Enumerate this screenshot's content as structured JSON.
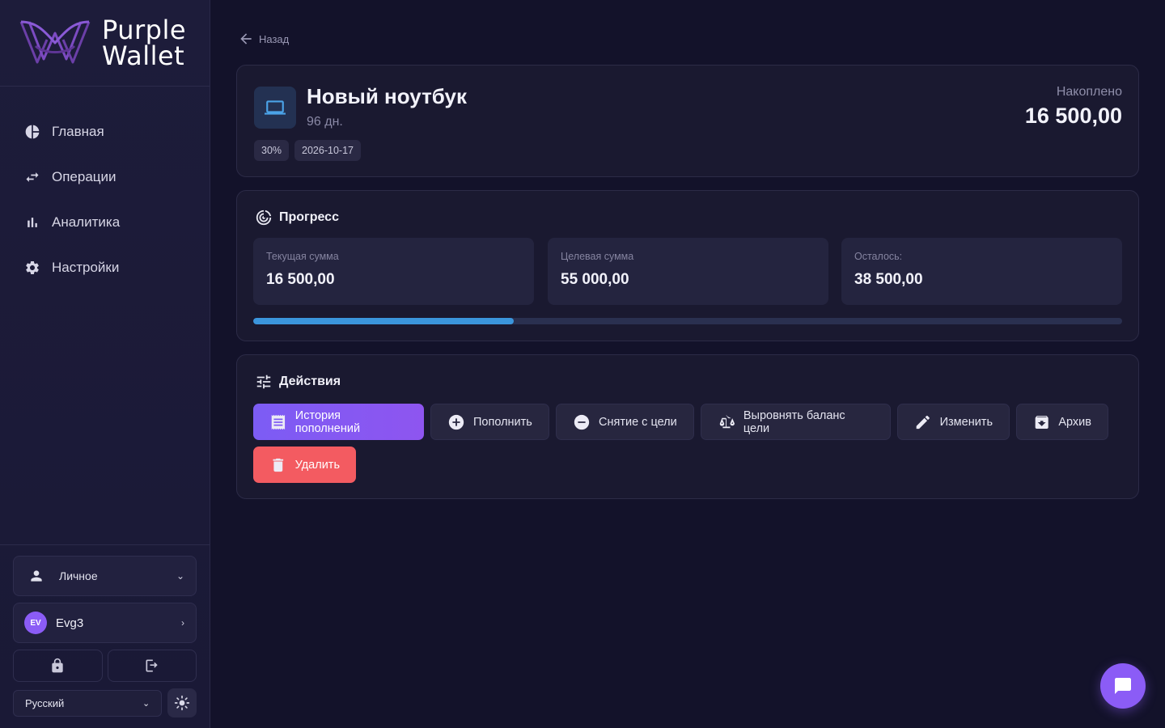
{
  "brand": {
    "line1": "Purple",
    "line2": "Wallet"
  },
  "nav": [
    {
      "label": "Главная",
      "icon": "pie-chart-icon"
    },
    {
      "label": "Операции",
      "icon": "transfer-arrows-icon"
    },
    {
      "label": "Аналитика",
      "icon": "bar-chart-icon"
    },
    {
      "label": "Настройки",
      "icon": "gear-icon"
    }
  ],
  "sidebar_bottom": {
    "account_type": "Личное",
    "user": {
      "initials": "EV",
      "name": "Evg3"
    },
    "language": "Русский"
  },
  "back_label": "Назад",
  "goal": {
    "title": "Новый ноутбук",
    "days": "96 дн.",
    "percent_chip": "30%",
    "date_chip": "2026-10-17",
    "accumulated_label": "Накоплено",
    "accumulated_value": "16 500,00",
    "icon": "laptop-icon"
  },
  "progress": {
    "title": "Прогресс",
    "current_label": "Текущая сумма",
    "current_value": "16 500,00",
    "target_label": "Целевая сумма",
    "target_value": "55 000,00",
    "remaining_label": "Осталось:",
    "remaining_value": "38 500,00",
    "fraction": 0.3
  },
  "actions": {
    "title": "Действия",
    "history": "История пополнений",
    "deposit": "Пополнить",
    "withdraw": "Снятие с цели",
    "balance": "Выровнять баланс цели",
    "edit": "Изменить",
    "archive": "Архив",
    "delete": "Удалить"
  },
  "colors": {
    "accent": "#8b5cf6",
    "progress": "#3b95dc",
    "danger": "#f35b61",
    "background": "#13122a"
  }
}
